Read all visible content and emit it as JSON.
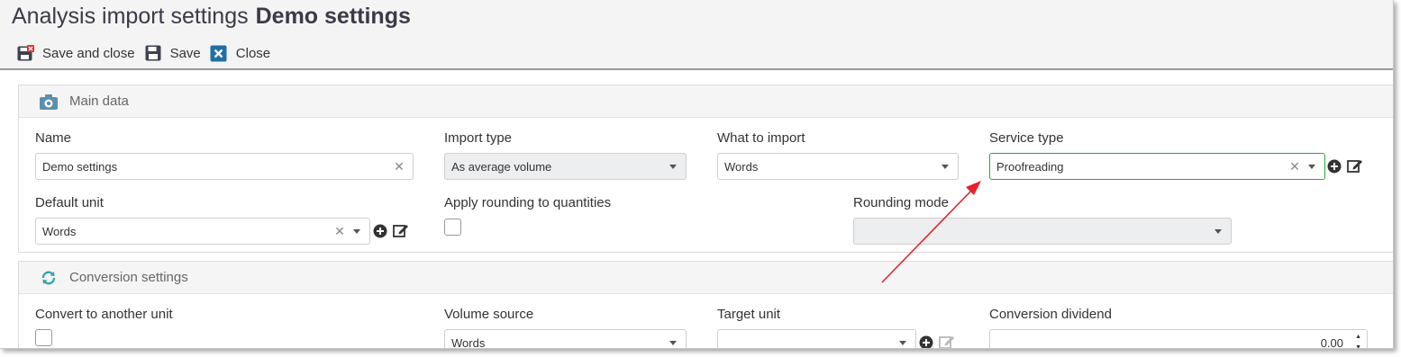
{
  "header": {
    "title": "Analysis import settings",
    "record_name": "Demo settings"
  },
  "toolbar": {
    "save_close_label": "Save and close",
    "save_label": "Save",
    "close_label": "Close"
  },
  "main_data": {
    "section_title": "Main data",
    "name": {
      "label": "Name",
      "value": "Demo settings"
    },
    "import_type": {
      "label": "Import type",
      "value": "As average volume"
    },
    "what_to_import": {
      "label": "What to import",
      "value": "Words"
    },
    "service_type": {
      "label": "Service type",
      "value": "Proofreading"
    },
    "default_unit": {
      "label": "Default unit",
      "value": "Words"
    },
    "apply_rounding": {
      "label": "Apply rounding to quantities",
      "checked": false
    },
    "rounding_mode": {
      "label": "Rounding mode",
      "value": ""
    }
  },
  "conversion": {
    "section_title": "Conversion settings",
    "convert_to_another_unit": {
      "label": "Convert to another unit",
      "checked": false
    },
    "volume_source": {
      "label": "Volume source",
      "value": "Words"
    },
    "target_unit": {
      "label": "Target unit",
      "value": ""
    },
    "conversion_dividend": {
      "label": "Conversion dividend",
      "value": "0.00"
    }
  },
  "colors": {
    "annotation_arrow": "#e8212a",
    "focus_border": "#27a744",
    "accent_icon": "#1f7fa8"
  },
  "icons": [
    "save-close-icon",
    "save-icon",
    "close-icon",
    "gear-icon",
    "refresh-icon",
    "plus-circle-icon",
    "edit-icon",
    "clear-icon",
    "chevron-down-icon"
  ]
}
